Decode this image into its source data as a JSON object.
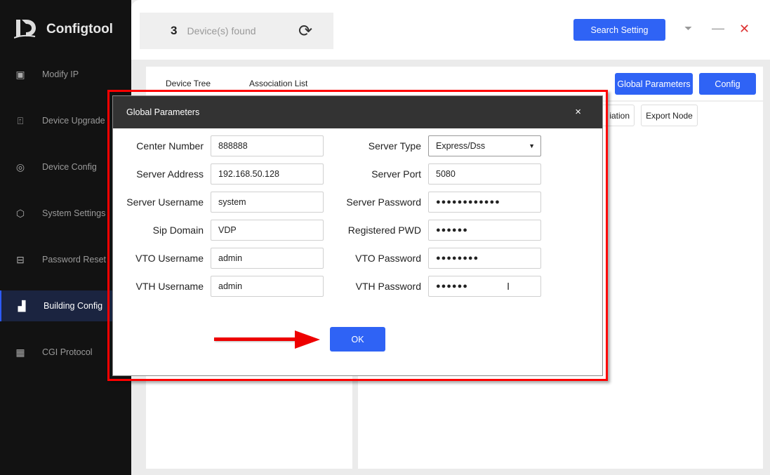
{
  "app": {
    "title": "Configtool"
  },
  "sidebar": {
    "items": [
      {
        "label": "Modify IP",
        "icon": "ip-icon"
      },
      {
        "label": "Device Upgrade",
        "icon": "upgrade-icon"
      },
      {
        "label": "Device Config",
        "icon": "target-icon"
      },
      {
        "label": "System Settings",
        "icon": "gear-icon"
      },
      {
        "label": "Password Reset",
        "icon": "lock-icon"
      },
      {
        "label": "Building Config",
        "icon": "bar-chart-icon"
      },
      {
        "label": "CGI Protocol",
        "icon": "grid-icon"
      }
    ]
  },
  "header": {
    "count": "3",
    "found_label": "Device(s) found",
    "search_setting": "Search Setting"
  },
  "tabs": [
    "Device Tree",
    "Association List"
  ],
  "toolbar": {
    "global_parameters": "Global Parameters",
    "config": "Config",
    "association": "iation",
    "export_node": "Export Node"
  },
  "dialog": {
    "title": "Global Parameters",
    "close": "×",
    "ok": "OK",
    "left_fields": [
      {
        "label": "Center Number",
        "value": "888888"
      },
      {
        "label": "Server Address",
        "value": "192.168.50.128"
      },
      {
        "label": "Server Username",
        "value": "system"
      },
      {
        "label": "Sip Domain",
        "value": "VDP"
      },
      {
        "label": "VTO Username",
        "value": "admin"
      },
      {
        "label": "VTH Username",
        "value": "admin"
      }
    ],
    "right_fields": [
      {
        "label": "Server Type",
        "value": "Express/Dss"
      },
      {
        "label": "Server Port",
        "value": "5080"
      },
      {
        "label": "Server Password",
        "value": "●●●●●●●●●●●●"
      },
      {
        "label": "Registered PWD",
        "value": "●●●●●●"
      },
      {
        "label": "VTO Password",
        "value": "●●●●●●●●"
      },
      {
        "label": "VTH Password",
        "value": "●●●●●●"
      }
    ]
  }
}
